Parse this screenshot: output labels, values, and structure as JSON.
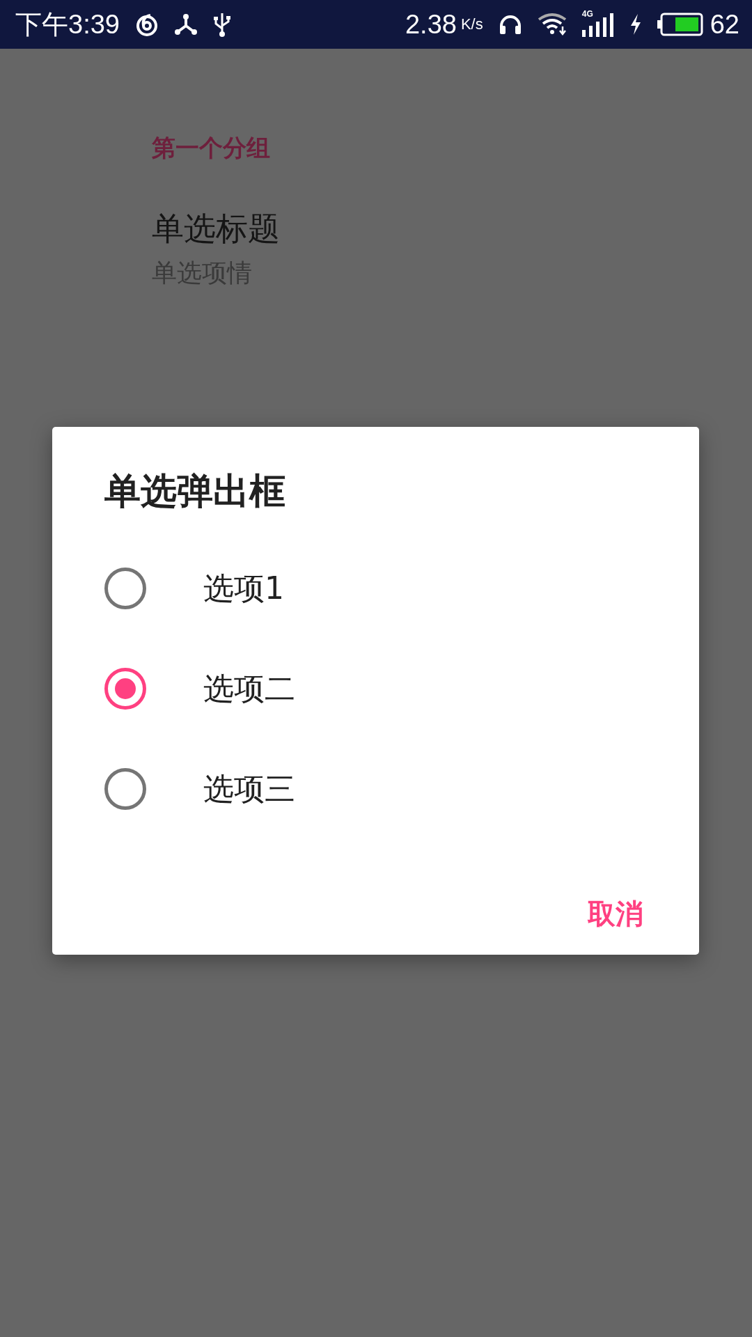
{
  "status_bar": {
    "time": "下午3:39",
    "speed": "2.38",
    "speed_unit": "K/s",
    "network": "4G",
    "battery": "62"
  },
  "preferences": {
    "category": "第一个分组",
    "item_title": "单选标题",
    "item_summary": "单选项情"
  },
  "dialog": {
    "title": "单选弹出框",
    "options": [
      {
        "label": "选项1",
        "selected": false
      },
      {
        "label": "选项二",
        "selected": true
      },
      {
        "label": "选项三",
        "selected": false
      }
    ],
    "buttons": [
      "取消"
    ]
  }
}
